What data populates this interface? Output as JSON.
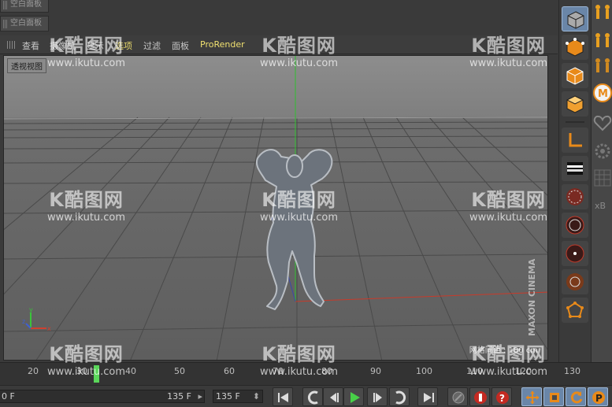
{
  "panels": [
    "空白面板",
    "空白面板"
  ],
  "menu": {
    "items": [
      "查看",
      "摄像机",
      "显示",
      "选项",
      "过滤",
      "面板",
      "ProRender"
    ]
  },
  "viewport": {
    "label": "透视视图",
    "grid_info": "网格间距 : 100 cm",
    "brand_top": "MAXON",
    "brand_bottom": "CINEMA"
  },
  "timeline": {
    "ticks": [
      "20",
      "30",
      "40",
      "50",
      "60",
      "70",
      "80",
      "90",
      "100",
      "110",
      "120",
      "130"
    ],
    "current_frame": 30
  },
  "transport": {
    "start_field": "0 F",
    "end_field": "135 F",
    "max_field": "135 F"
  },
  "watermark": {
    "logo": "K酷图网",
    "url": "www.ikutu.com"
  },
  "colors": {
    "accent_active": "#6a86a8",
    "axis_x": "#c83a2a",
    "axis_y": "#3ac43a",
    "playhead": "#5ad65a",
    "pro_render": "#f0e070"
  }
}
